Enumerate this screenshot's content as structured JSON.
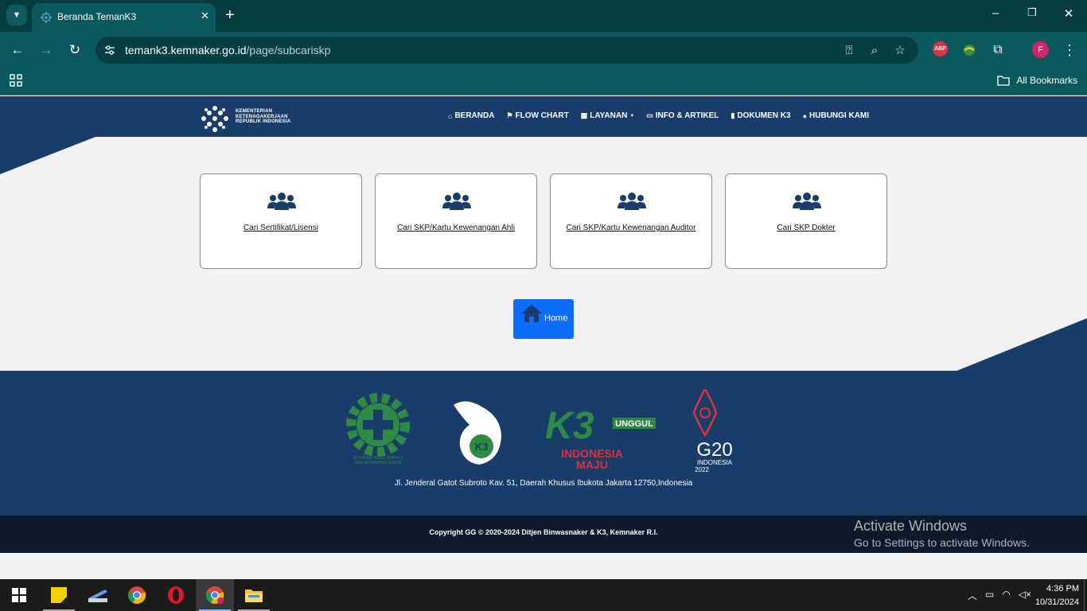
{
  "browser": {
    "tab_title": "Beranda TemanK3",
    "tab_close": "✕",
    "new_tab": "+",
    "url_host": "temank3.kemnaker.go.id",
    "url_path": "/page/subcariskp",
    "all_bookmarks": "All Bookmarks",
    "profile_initial": "F",
    "abp_label": "ABP",
    "accent_color": "#0a5a5d"
  },
  "site": {
    "logo_lines": [
      "KEMENTERIAN",
      "KETENAGAKERJAAN",
      "REPUBLIK INDONESIA"
    ],
    "menu": [
      {
        "label": "BERANDA",
        "icon": "home-icon"
      },
      {
        "label": "FLOW CHART",
        "icon": "flag-icon"
      },
      {
        "label": "LAYANAN",
        "icon": "grid-icon",
        "dropdown": true
      },
      {
        "label": "INFO & ARTIKEL",
        "icon": "card-icon"
      },
      {
        "label": "DOKUMEN K3",
        "icon": "book-icon"
      },
      {
        "label": "HUBUNGI KAMI",
        "icon": "user-icon"
      }
    ],
    "cards": [
      {
        "label": "Cari Sertifikat/Lisensi",
        "icon": "users-icon"
      },
      {
        "label": "Cari SKP/Kartu Kewenangan Ahli",
        "icon": "users-icon"
      },
      {
        "label": "Cari SKP/Kartu Kewenangan Auditor",
        "icon": "users-icon"
      },
      {
        "label": "Cari SKP Dokter",
        "icon": "users-icon"
      }
    ],
    "home_button": "Home",
    "footer_logos": {
      "k3_small_text": [
        "STANDAR KESELAMATAN",
        "DAN KESEHATAN KERJA"
      ],
      "k3_badge": "K3",
      "unggul": "UNGGUL",
      "indonesia_maju": [
        "INDONESIA",
        "MAJU"
      ],
      "g20": [
        "G20",
        "INDONESIA",
        "2022"
      ]
    },
    "address": "Jl. Jenderal Gatot Subroto Kav. 51, Daerah Khusus Ibukota Jakarta 12750,Indonesia",
    "copyright": "Copyright GG © 2020-2024 Ditjen Binwasnaker & K3, Kemnaker R.I.",
    "nav_color": "#183d69"
  },
  "watermark": {
    "title": "Activate Windows",
    "subtitle": "Go to Settings to activate Windows."
  },
  "taskbar": {
    "time": "4:36 PM",
    "date": "10/31/2024"
  }
}
